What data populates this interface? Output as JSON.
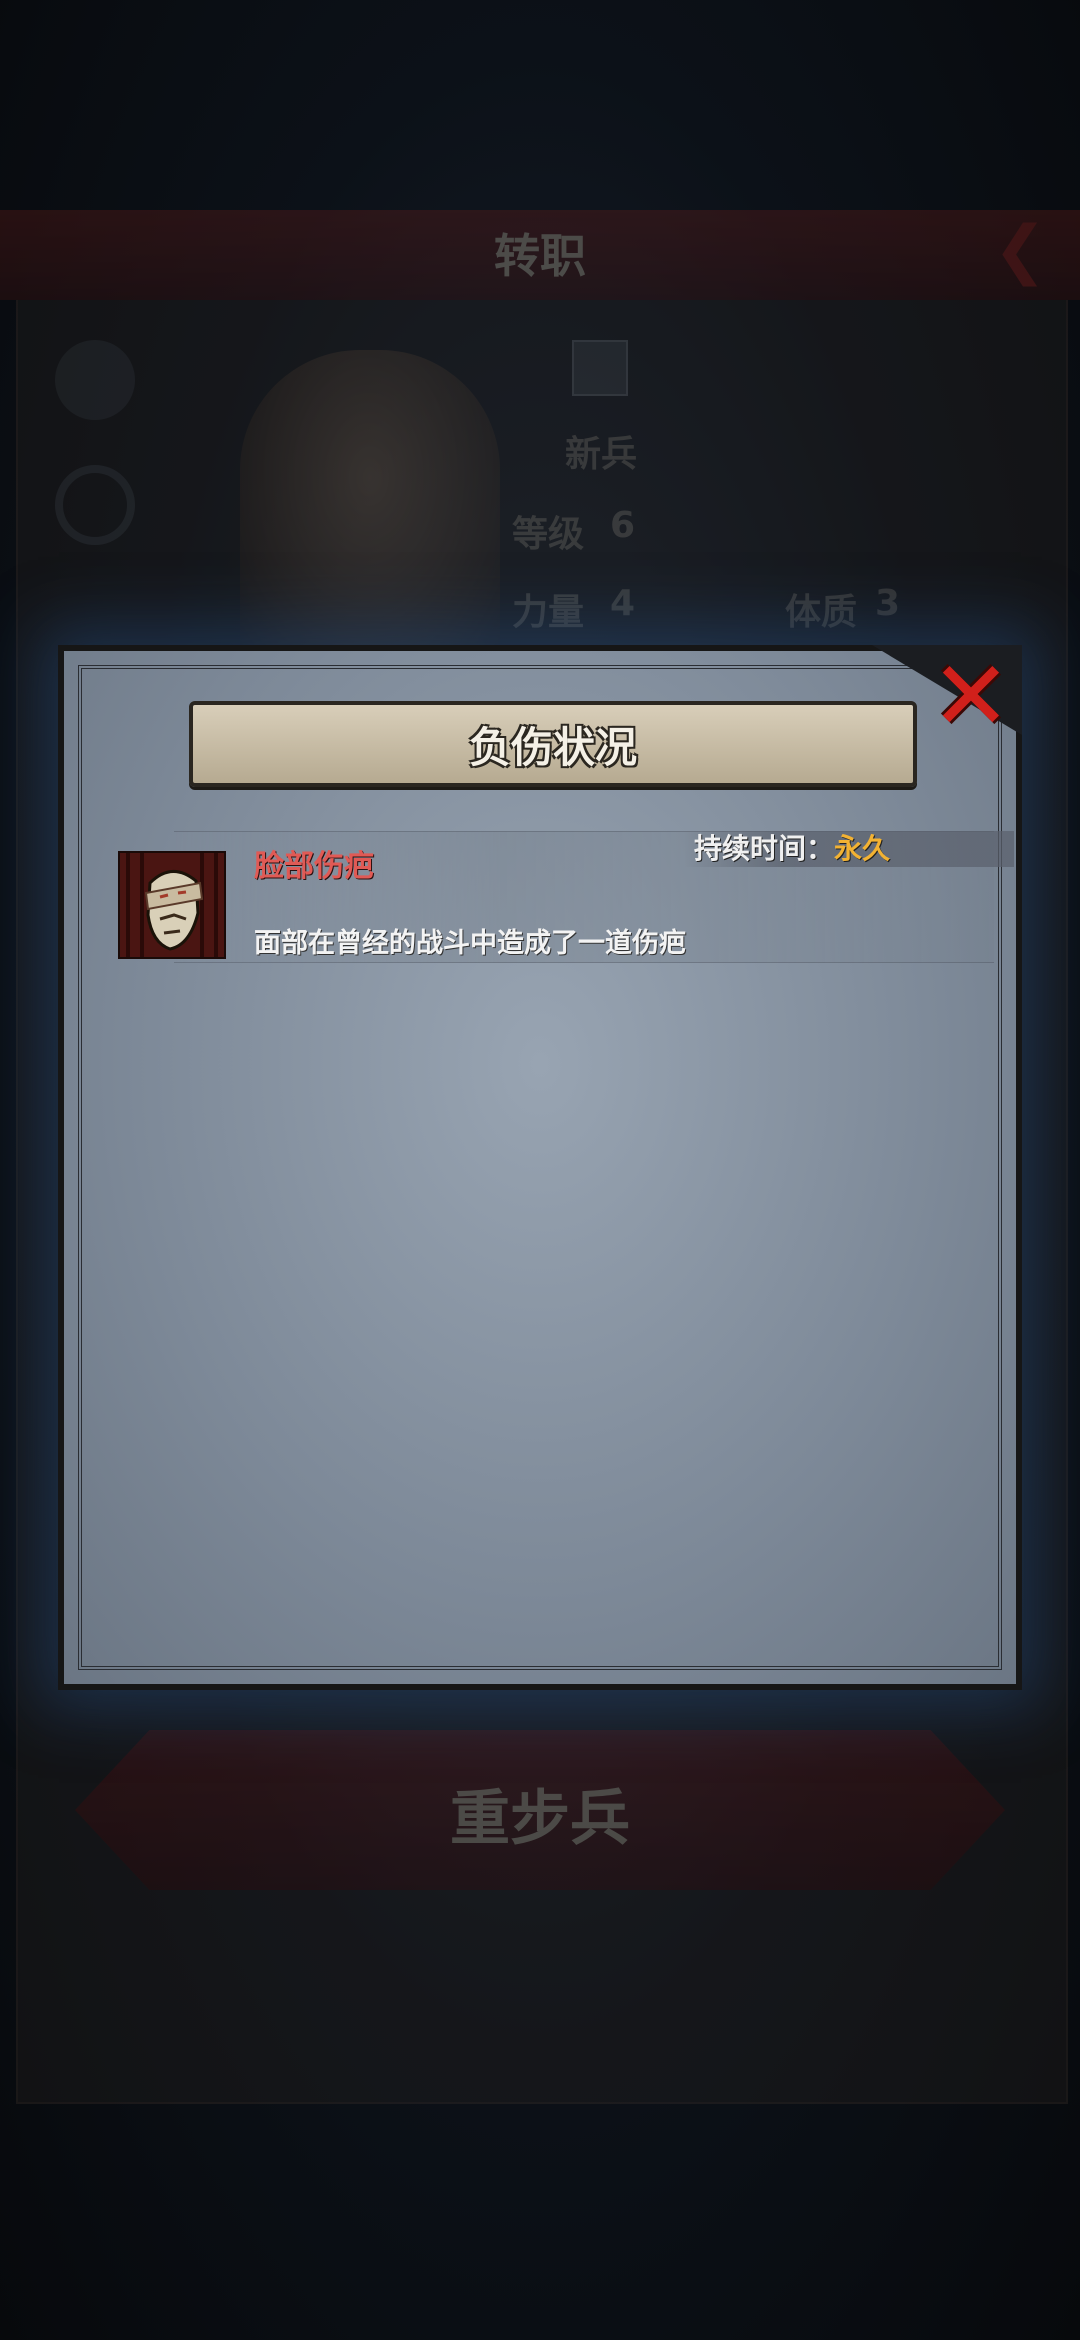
{
  "background": {
    "title": "转职",
    "class_name": "新兵",
    "level_label": "等级",
    "level_value": "6",
    "strength_label": "力量",
    "strength_value": "4",
    "constitution_label": "体质",
    "constitution_value": "3",
    "next_class_button": "重步兵"
  },
  "dialog": {
    "title": "负伤状况",
    "injuries": [
      {
        "name": "脸部伤疤",
        "duration_label": "持续时间：",
        "duration_value": "永久",
        "description": "面部在曾经的战斗中造成了一道伤疤"
      }
    ]
  },
  "colors": {
    "injury_name": "#e05a55",
    "duration_value": "#f2b233",
    "close_x": "#d1201b"
  }
}
